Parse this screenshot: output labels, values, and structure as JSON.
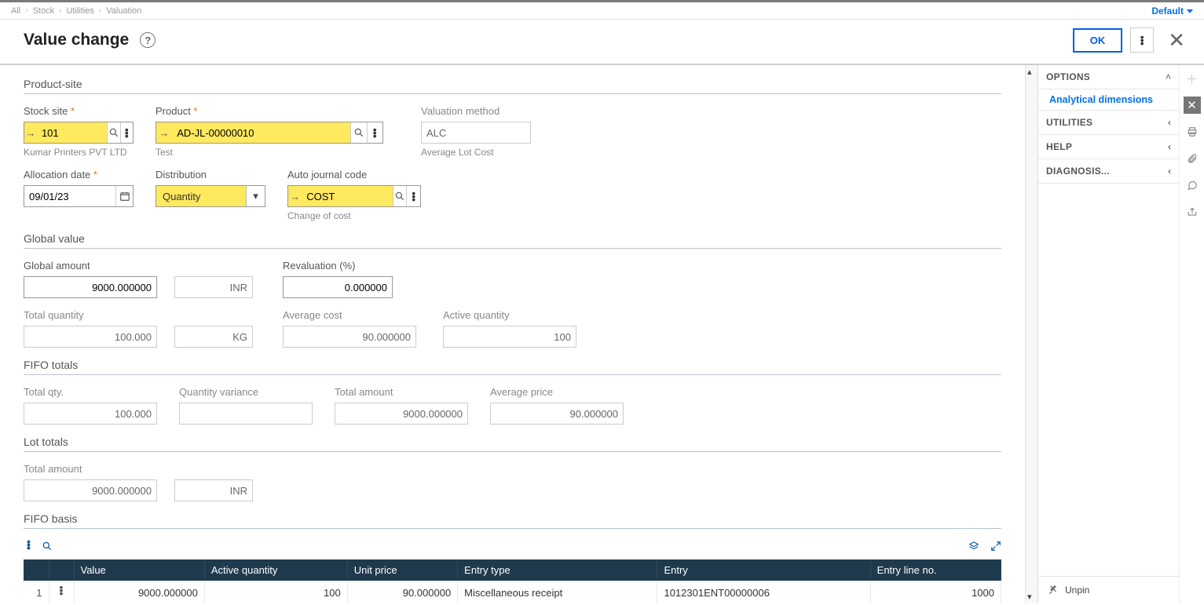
{
  "breadcrumbs": [
    "All",
    "Stock",
    "Utilities",
    "Valuation"
  ],
  "default_label": "Default",
  "header": {
    "title": "Value change",
    "ok": "OK"
  },
  "sections": {
    "product_site": "Product-site",
    "global_value": "Global value",
    "fifo_totals": "FIFO totals",
    "lot_totals": "Lot totals",
    "fifo_basis": "FIFO basis"
  },
  "fields": {
    "stock_site": {
      "label": "Stock site",
      "value": "101",
      "sub": "Kumar Printers PVT LTD"
    },
    "product": {
      "label": "Product",
      "value": "AD-JL-00000010",
      "sub": "Test"
    },
    "valuation_method": {
      "label": "Valuation method",
      "value": "ALC",
      "sub": "Average Lot Cost"
    },
    "allocation_date": {
      "label": "Allocation date",
      "value": "09/01/23"
    },
    "distribution": {
      "label": "Distribution",
      "value": "Quantity"
    },
    "auto_journal": {
      "label": "Auto journal code",
      "value": "COST",
      "sub": "Change of cost"
    },
    "global_amount": {
      "label": "Global amount",
      "value": "9000.000000",
      "currency": "INR"
    },
    "revaluation": {
      "label": "Revaluation (%)",
      "value": "0.000000"
    },
    "total_quantity": {
      "label": "Total quantity",
      "value": "100.000",
      "uom": "KG"
    },
    "average_cost": {
      "label": "Average cost",
      "value": "90.000000"
    },
    "active_quantity": {
      "label": "Active quantity",
      "value": "100"
    },
    "fifo_total_qty": {
      "label": "Total qty.",
      "value": "100.000"
    },
    "fifo_qty_variance": {
      "label": "Quantity variance",
      "value": ""
    },
    "fifo_total_amount": {
      "label": "Total amount",
      "value": "9000.000000"
    },
    "fifo_avg_price": {
      "label": "Average price",
      "value": "90.000000"
    },
    "lot_total_amount": {
      "label": "Total amount",
      "value": "9000.000000",
      "currency": "INR"
    }
  },
  "table": {
    "headers": [
      "Value",
      "Active quantity",
      "Unit price",
      "Entry type",
      "Entry",
      "Entry line no."
    ],
    "rows": [
      {
        "n": "1",
        "value": "9000.000000",
        "active_qty": "100",
        "unit_price": "90.000000",
        "entry_type": "Miscellaneous receipt",
        "entry": "1012301ENT00000006",
        "entry_line_no": "1000"
      }
    ]
  },
  "right": {
    "options": "OPTIONS",
    "analytical": "Analytical dimensions",
    "utilities": "UTILITIES",
    "help": "HELP",
    "diagnosis": "DIAGNOSIS...",
    "unpin": "Unpin"
  }
}
